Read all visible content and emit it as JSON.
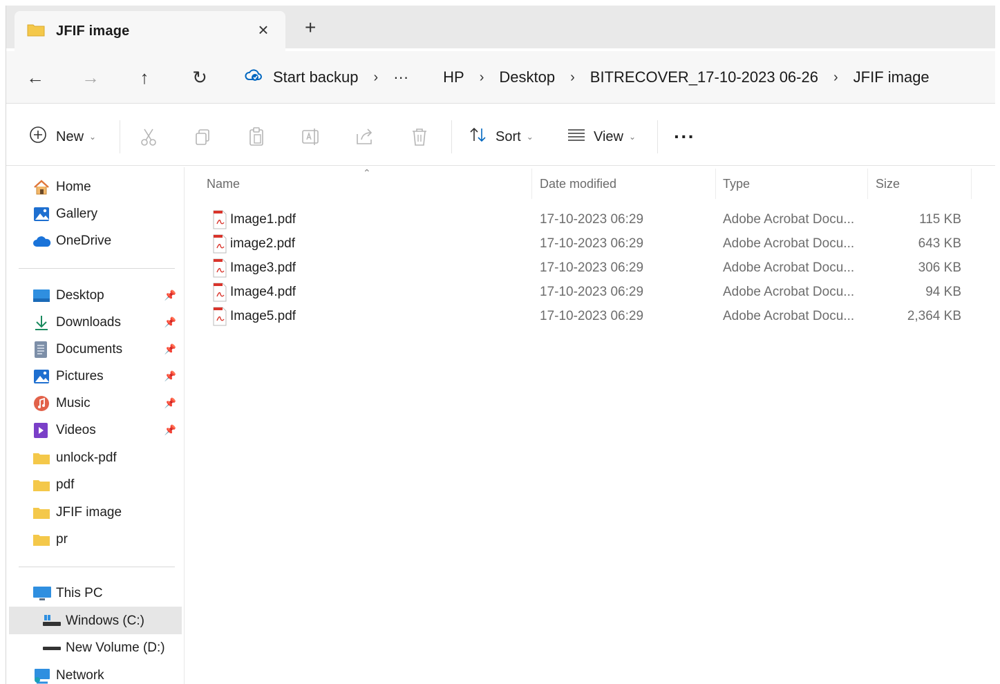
{
  "tab": {
    "title": "JFIF image",
    "close_glyph": "×",
    "add_glyph": "+"
  },
  "nav": {
    "back": "←",
    "forward": "→",
    "up": "↑",
    "refresh": "↻"
  },
  "breadcrumbs": {
    "start_backup": "Start backup",
    "more": "···",
    "items": [
      "HP",
      "Desktop",
      "BITRECOVER_17-10-2023 06-26",
      "JFIF image"
    ],
    "separator": "›"
  },
  "toolbar": {
    "new_label": "New",
    "sort_label": "Sort",
    "view_label": "View",
    "more_label": "···",
    "chevron": "⌄"
  },
  "sidebar": {
    "quick": [
      {
        "label": "Home",
        "icon": "home-icon"
      },
      {
        "label": "Gallery",
        "icon": "gallery-icon"
      },
      {
        "label": "OneDrive",
        "icon": "cloud-icon"
      }
    ],
    "pinned": [
      {
        "label": "Desktop",
        "icon": "desktop-icon",
        "pinned": true
      },
      {
        "label": "Downloads",
        "icon": "download-icon",
        "pinned": true
      },
      {
        "label": "Documents",
        "icon": "documents-icon",
        "pinned": true
      },
      {
        "label": "Pictures",
        "icon": "pictures-icon",
        "pinned": true
      },
      {
        "label": "Music",
        "icon": "music-icon",
        "pinned": true
      },
      {
        "label": "Videos",
        "icon": "videos-icon",
        "pinned": true
      },
      {
        "label": "unlock-pdf",
        "icon": "folder-icon",
        "pinned": false
      },
      {
        "label": "pdf",
        "icon": "folder-icon",
        "pinned": false
      },
      {
        "label": "JFIF image",
        "icon": "folder-icon",
        "pinned": false
      },
      {
        "label": "pr",
        "icon": "folder-icon",
        "pinned": false
      }
    ],
    "devices": [
      {
        "label": "This PC",
        "icon": "computer-icon"
      },
      {
        "label": "Windows (C:)",
        "icon": "drive-icon",
        "selected": true
      },
      {
        "label": "New Volume (D:)",
        "icon": "drive-icon"
      },
      {
        "label": "Network",
        "icon": "network-icon"
      }
    ]
  },
  "columns": {
    "name": "Name",
    "date": "Date modified",
    "type": "Type",
    "size": "Size"
  },
  "files": [
    {
      "name": "Image1.pdf",
      "date": "17-10-2023 06:29",
      "type": "Adobe Acrobat Docu...",
      "size": "115 KB"
    },
    {
      "name": "image2.pdf",
      "date": "17-10-2023 06:29",
      "type": "Adobe Acrobat Docu...",
      "size": "643 KB"
    },
    {
      "name": "Image3.pdf",
      "date": "17-10-2023 06:29",
      "type": "Adobe Acrobat Docu...",
      "size": "306 KB"
    },
    {
      "name": "Image4.pdf",
      "date": "17-10-2023 06:29",
      "type": "Adobe Acrobat Docu...",
      "size": "94 KB"
    },
    {
      "name": "Image5.pdf",
      "date": "17-10-2023 06:29",
      "type": "Adobe Acrobat Docu...",
      "size": "2,364 KB"
    }
  ],
  "colors": {
    "folder": "#f4c84a",
    "pdf": "#d9342b",
    "accent": "#0067c0",
    "pin": "#777777"
  }
}
